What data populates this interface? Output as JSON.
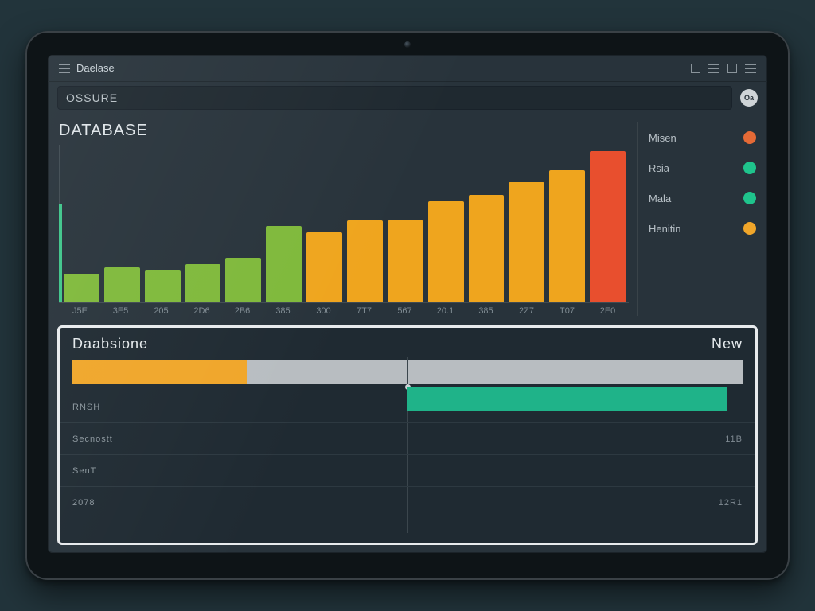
{
  "titlebar": {
    "title": "Daelase"
  },
  "search": {
    "label": "OSSURE",
    "badge": "Oa"
  },
  "chart": {
    "title": "DATABASE"
  },
  "chart_data": {
    "type": "bar",
    "categories": [
      "J5E",
      "3E5",
      "205",
      "2D6",
      "2B6",
      "385",
      "300",
      "7T7",
      "567",
      "20.1",
      "385",
      "2Z7",
      "T07",
      "2E0"
    ],
    "values": [
      18,
      22,
      20,
      24,
      28,
      48,
      44,
      52,
      52,
      64,
      68,
      76,
      84,
      96
    ],
    "colors": [
      "#7fb93b",
      "#7fb93b",
      "#7fb93b",
      "#7fb93b",
      "#7fb93b",
      "#7fb93b",
      "#efa51e",
      "#efa51e",
      "#efa51e",
      "#efa51e",
      "#efa51e",
      "#efa51e",
      "#efa51e",
      "#e84f2e"
    ],
    "ylim": [
      0,
      100
    ],
    "title": "DATABASE",
    "xlabel": "",
    "ylabel": ""
  },
  "legend": {
    "items": [
      {
        "label": "Misen",
        "color": "#e56a36"
      },
      {
        "label": "Rsia",
        "color": "#1fc48c"
      },
      {
        "label": "Mala",
        "color": "#1fc48c"
      },
      {
        "label": "Henitin",
        "color": "#f0a62a"
      }
    ]
  },
  "lower": {
    "title": "Daabsione",
    "action": "New",
    "track": [
      {
        "color": "#f0a62a",
        "width": 26
      },
      {
        "color": "#b8bdc1",
        "width": 74
      }
    ],
    "rows": [
      {
        "label": "RNSH",
        "right": ""
      },
      {
        "label": "Secnostt",
        "right": "11B"
      },
      {
        "label": "SenT",
        "right": ""
      },
      {
        "label": "2078",
        "right": "12R1"
      }
    ]
  }
}
